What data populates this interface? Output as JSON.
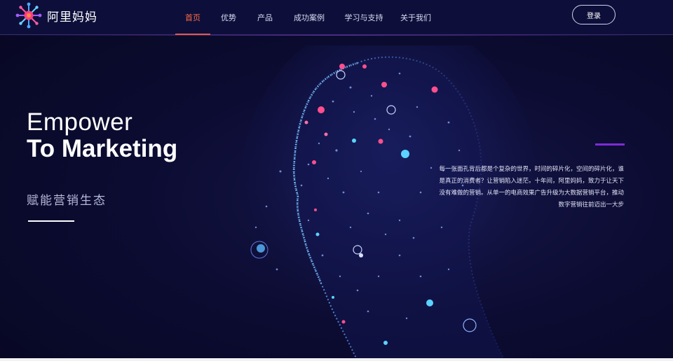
{
  "brand": {
    "name": "阿里妈妈",
    "logo_icon": "burst-flower-icon",
    "colors": {
      "accent": "#ff6b45",
      "purple": "#7e2bd6",
      "bg": "#0c0c33"
    }
  },
  "nav": {
    "items": [
      {
        "label": "首页",
        "active": true
      },
      {
        "label": "优势",
        "active": false
      },
      {
        "label": "产品",
        "active": false
      },
      {
        "label": "成功案例",
        "active": false
      },
      {
        "label": "学习与支持",
        "active": false
      },
      {
        "label": "关于我们",
        "active": false
      }
    ],
    "login_label": "登录"
  },
  "hero": {
    "line1": "Empower",
    "line2": "To Marketing",
    "subtitle": "赋能营销生态",
    "description_lines": [
      "每一张面孔背后都是个复杂的世界，时间的碎片化，空间的碎片化，谁",
      "是真正的消费者？让营销陷入迷茫。十年间，阿里妈妈，致力于让天下",
      "没有难做的营销。从单一的电商效果广告升级为大数据营销平台，推动",
      "数字营销往前迈出一大步"
    ],
    "visual_icon": "particle-face-illustration"
  }
}
